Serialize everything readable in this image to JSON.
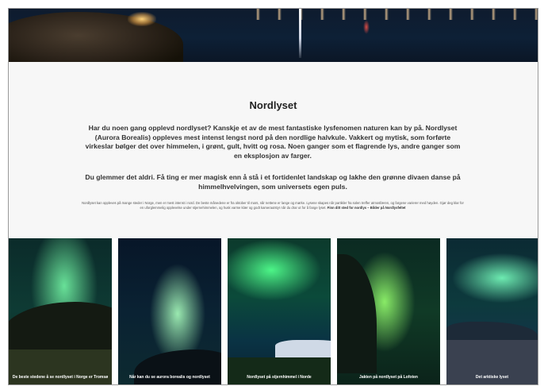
{
  "article": {
    "title": "Nordlyset",
    "paragraph1": "Har du noen gang opplevd nordlyset? Kanskje et av de mest fantastiske lysfenomen naturen kan by på. Nordlyset (Aurora Borealis) oppleves mest intenst lengst nord på den nordlige halvkule. Vakkert og mytisk, som forførte virkeslar bølger det over himmelen, i grønt, gult, hvitt og rosa. Noen ganger som et flagrende lys, andre ganger som en eksplosjon av farger.",
    "paragraph2": "Du glemmer det aldri. Få ting er mer magisk enn å stå i et fortidenlet landskap og lakhe den grønne divaen danse på himmelhvelvingen, som universets egen puls.",
    "fineprint": "Nordlyset kan oppleves på mange steder i Norge, men er mest intenst i nord. De beste månedene er fra oktober til mars, når nettene er lange og mørke. Lysene skapes når partikler fra solen treffer atmosfæren, og fargene varierer med høyden. Gjør deg klar for en uforglemmelig opplevelse under stjernehimmelen, og husk varme klær og godt kamerautstyr når du drar ut for å fange lyset.",
    "fineprint_link": "Finn ditt sted for nordlys – Bilder på Nordlysfeltet"
  },
  "gallery": [
    {
      "caption": "De beste stedene å se nordlyset i Norge er Tromsø"
    },
    {
      "caption": "Når kan du se aurora borealis og nordlyset"
    },
    {
      "caption": "Nordlyset på stjernhimmel i Norde"
    },
    {
      "caption": "Jakten på nordlyset på Lofoten"
    },
    {
      "caption": "Det arktiske lyset"
    }
  ],
  "colors": {
    "background": "#f7f7f7",
    "aurora_green": "#3cff88",
    "text": "#333333"
  }
}
